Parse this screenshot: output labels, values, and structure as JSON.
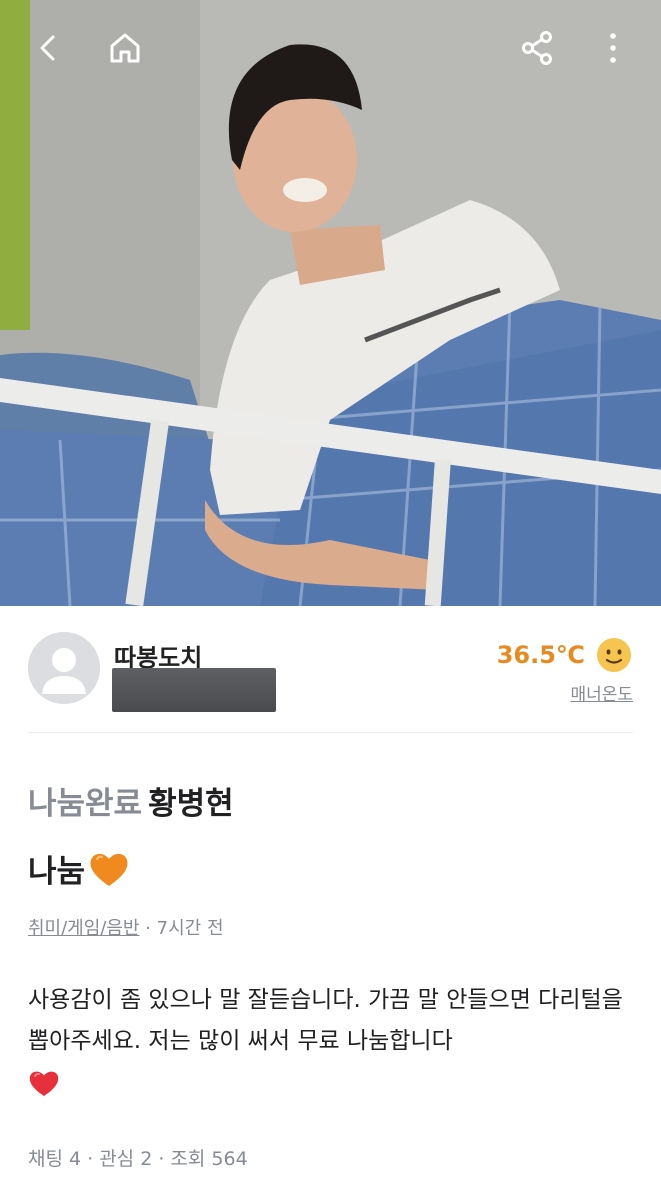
{
  "topbar": {
    "back_icon": "back-arrow-icon",
    "home_icon": "home-icon",
    "share_icon": "share-icon",
    "more_icon": "more-vertical-icon"
  },
  "seller": {
    "nickname": "따봉도치",
    "temperature": "36.5℃",
    "manner_label": "매너온도",
    "temperature_color": "#e78a1f"
  },
  "post": {
    "status": "나눔완료",
    "title": "황병현",
    "subtitle": "나눔",
    "category": "취미/게임/음반",
    "time": " · 7시간 전",
    "description": "사용감이 좀 있으나 말 잘듣습니다. 가끔 말 안들으면 다리털을 뽑아주세요. 저는 많이 써서 무료 나눔합니다",
    "stats": "채팅 4 · 관심 2 · 조회 564"
  },
  "colors": {
    "status_gray": "#868b94",
    "text_dark": "#212124",
    "heart_red": "#e8303c",
    "heart_orange": "#f08a1e"
  }
}
